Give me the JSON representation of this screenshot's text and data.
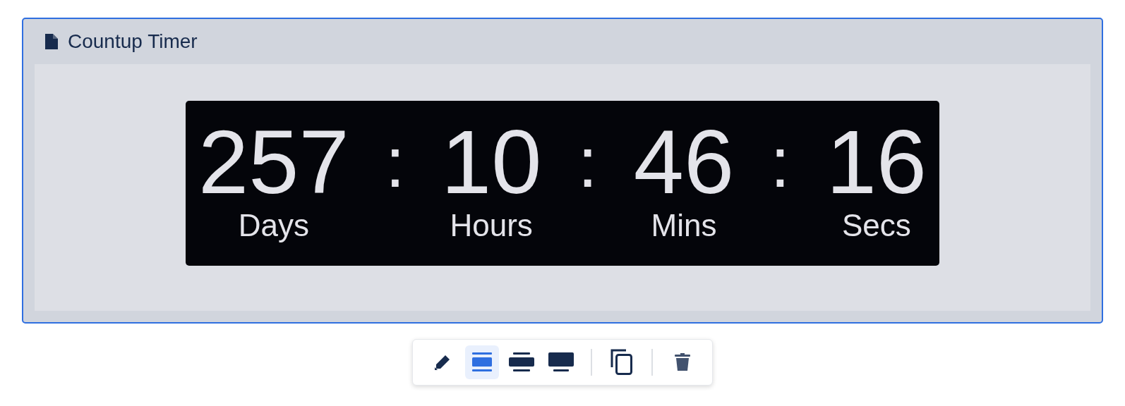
{
  "panel": {
    "title": "Countup Timer"
  },
  "timer": {
    "separator": ":",
    "units": [
      {
        "value": "257",
        "label": "Days"
      },
      {
        "value": "10",
        "label": "Hours"
      },
      {
        "value": "46",
        "label": "Mins"
      },
      {
        "value": "16",
        "label": "Secs"
      }
    ]
  },
  "toolbar": {
    "buttons": [
      {
        "kind": "edit",
        "selected": false
      },
      {
        "kind": "layout-full",
        "selected": true
      },
      {
        "kind": "layout-wide",
        "selected": false
      },
      {
        "kind": "layout-screen",
        "selected": false
      },
      {
        "kind": "divider"
      },
      {
        "kind": "copy",
        "selected": false
      },
      {
        "kind": "divider"
      },
      {
        "kind": "delete",
        "selected": false
      }
    ]
  }
}
